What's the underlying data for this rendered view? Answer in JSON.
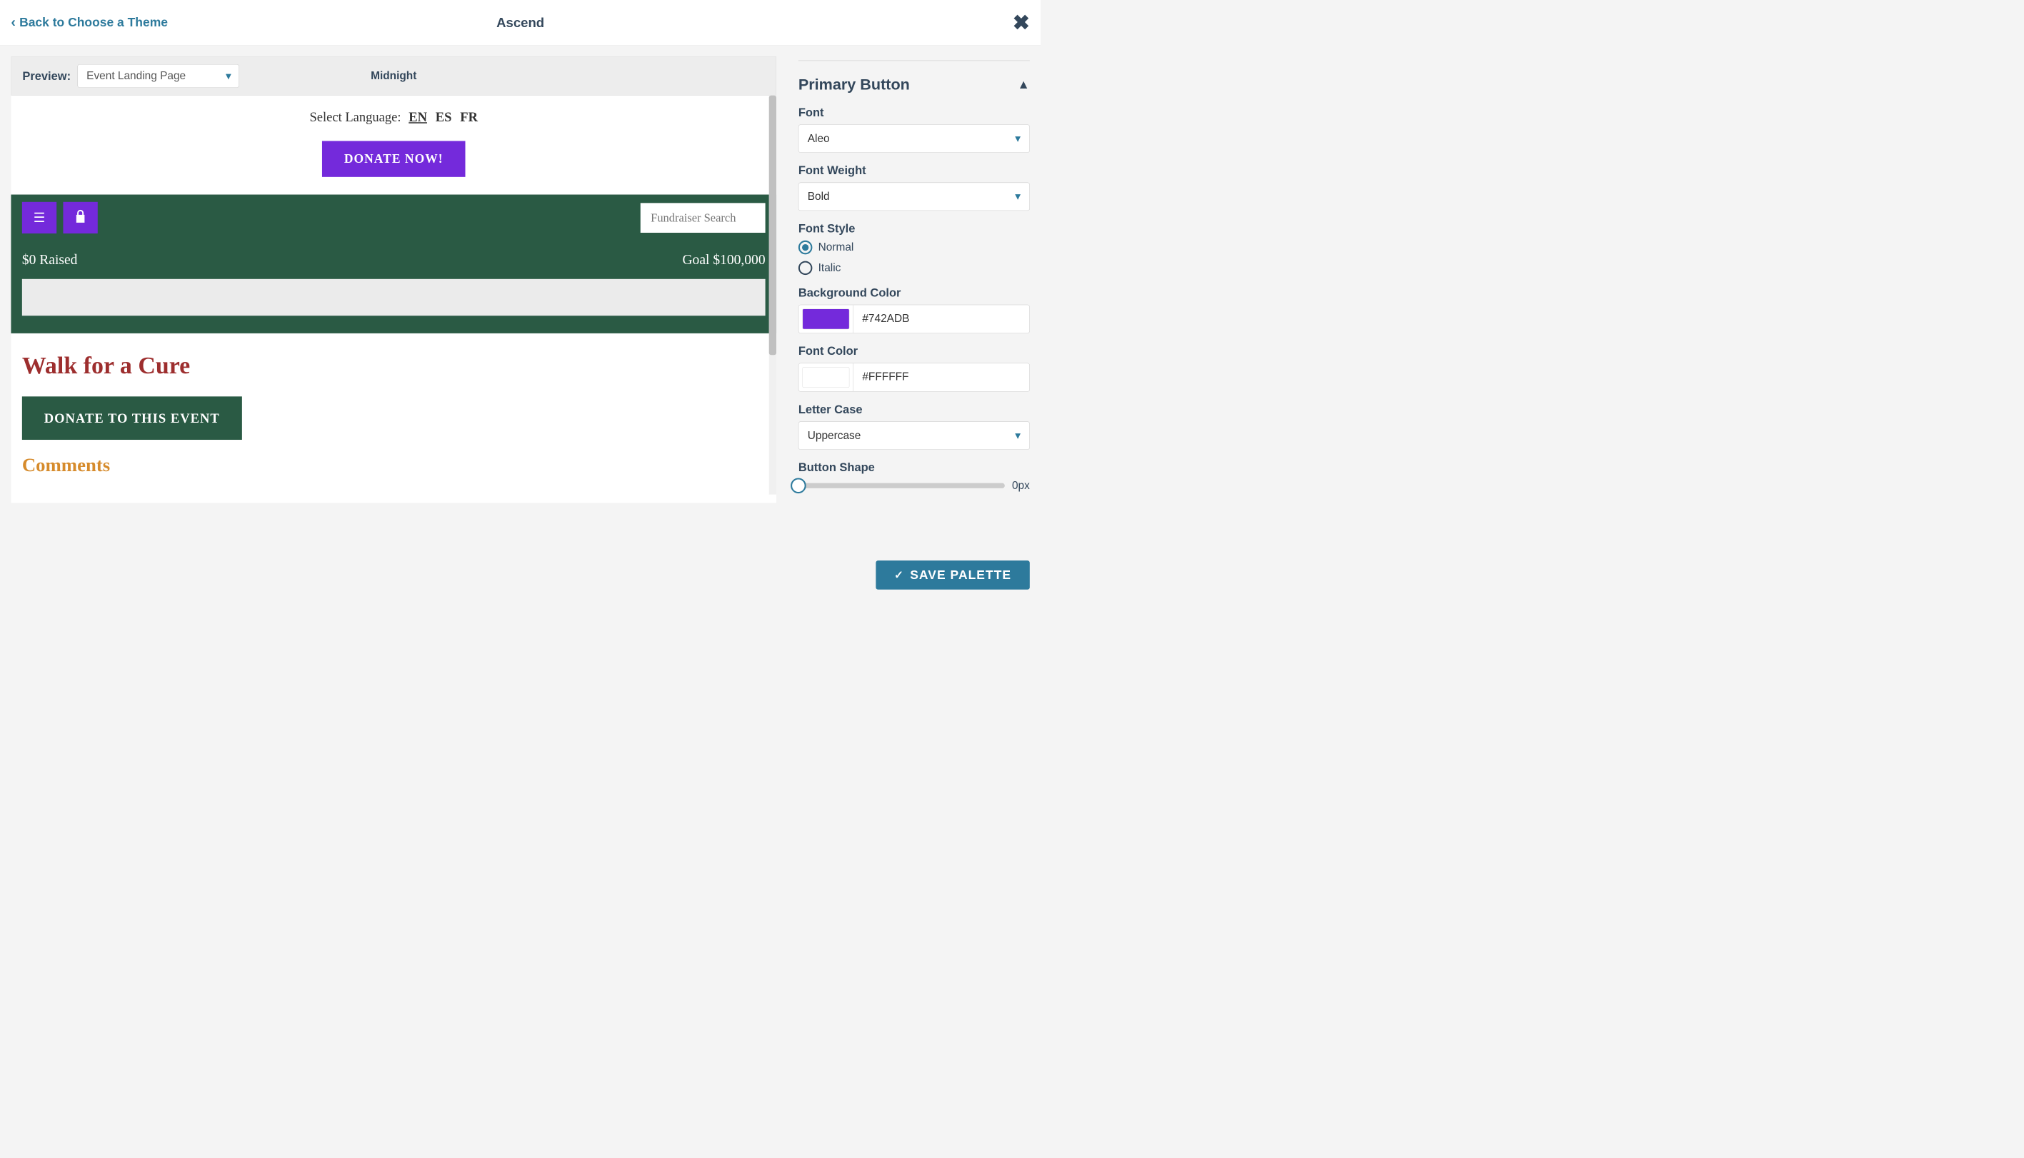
{
  "topbar": {
    "back_label": "Back to Choose a Theme",
    "title": "Ascend"
  },
  "preview": {
    "label": "Preview:",
    "selected_page": "Event Landing Page",
    "theme_name": "Midnight"
  },
  "preview_content": {
    "lang_label": "Select Language:",
    "lang_en": "EN",
    "lang_es": "ES",
    "lang_fr": "FR",
    "donate_now": "DONATE NOW!",
    "search_placeholder": "Fundraiser Search",
    "raised": "$0 Raised",
    "goal": "Goal $100,000",
    "event_title": "Walk for a Cure",
    "donate_event": "DONATE TO THIS EVENT",
    "comments": "Comments"
  },
  "sidebar": {
    "section_title": "Primary Button",
    "font_label": "Font",
    "font_value": "Aleo",
    "weight_label": "Font Weight",
    "weight_value": "Bold",
    "style_label": "Font Style",
    "style_normal": "Normal",
    "style_italic": "Italic",
    "bg_label": "Background Color",
    "bg_value": "#742ADB",
    "font_color_label": "Font Color",
    "font_color_value": "#FFFFFF",
    "case_label": "Letter Case",
    "case_value": "Uppercase",
    "shape_label": "Button Shape",
    "shape_value": "0px"
  },
  "save_label": "SAVE PALETTE"
}
